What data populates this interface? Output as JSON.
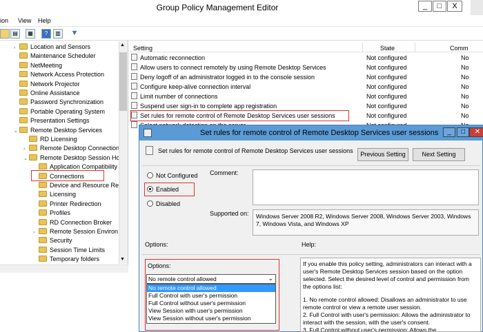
{
  "window": {
    "title": "Group Policy Management Editor",
    "min": "_",
    "max": "□",
    "close": "X"
  },
  "menu": [
    "ion",
    "View",
    "Help"
  ],
  "tree": [
    {
      "label": "Location and Sensors",
      "level": 1,
      "exp": "›"
    },
    {
      "label": "Maintenance Scheduler",
      "level": 1,
      "exp": ""
    },
    {
      "label": "NetMeeting",
      "level": 1,
      "exp": ""
    },
    {
      "label": "Network Access Protection",
      "level": 1,
      "exp": ""
    },
    {
      "label": "Network Projector",
      "level": 1,
      "exp": ""
    },
    {
      "label": "Online Assistance",
      "level": 1,
      "exp": ""
    },
    {
      "label": "Password Synchronization",
      "level": 1,
      "exp": ""
    },
    {
      "label": "Portable Operating System",
      "level": 1,
      "exp": ""
    },
    {
      "label": "Presentation Settings",
      "level": 1,
      "exp": ""
    },
    {
      "label": "Remote Desktop Services",
      "level": 1,
      "exp": "⌄"
    },
    {
      "label": "RD Licensing",
      "level": 2,
      "exp": ""
    },
    {
      "label": "Remote Desktop Connection",
      "level": 2,
      "exp": "›"
    },
    {
      "label": "Remote Desktop Session Hos",
      "level": 2,
      "exp": "⌄"
    },
    {
      "label": "Application Compatibility",
      "level": 3,
      "exp": ""
    },
    {
      "label": "Connections",
      "level": 3,
      "exp": ""
    },
    {
      "label": "Device and Resource Red",
      "level": 3,
      "exp": ""
    },
    {
      "label": "Licensing",
      "level": 3,
      "exp": ""
    },
    {
      "label": "Printer Redirection",
      "level": 3,
      "exp": ""
    },
    {
      "label": "Profiles",
      "level": 3,
      "exp": ""
    },
    {
      "label": "RD Connection Broker",
      "level": 3,
      "exp": ""
    },
    {
      "label": "Remote Session Environ",
      "level": 3,
      "exp": "›"
    },
    {
      "label": "Security",
      "level": 3,
      "exp": ""
    },
    {
      "label": "Session Time Limits",
      "level": 3,
      "exp": ""
    },
    {
      "label": "Temporary folders",
      "level": 3,
      "exp": ""
    }
  ],
  "list": {
    "headers": {
      "setting": "Setting",
      "state": "State",
      "comment": "Comm"
    },
    "rows": [
      {
        "setting": "Automatic reconnection",
        "state": "Not configured",
        "comment": "No"
      },
      {
        "setting": "Allow users to connect remotely by using Remote Desktop Services",
        "state": "Not configured",
        "comment": "No"
      },
      {
        "setting": "Deny logoff of an administrator logged in to the console session",
        "state": "Not configured",
        "comment": "No"
      },
      {
        "setting": "Configure keep-alive connection interval",
        "state": "Not configured",
        "comment": "No"
      },
      {
        "setting": "Limit number of connections",
        "state": "Not configured",
        "comment": "No"
      },
      {
        "setting": "Suspend user sign-in to complete app registration",
        "state": "Not configured",
        "comment": "No"
      },
      {
        "setting": "Set rules for remote control of Remote Desktop Services user sessions",
        "state": "Not configured",
        "comment": "No"
      },
      {
        "setting": "Select network detection on the server",
        "state": "Not configured",
        "comment": "No"
      }
    ]
  },
  "dialog": {
    "title": "Set rules for remote control of Remote Desktop Services user sessions",
    "heading": "Set rules for remote control of Remote Desktop Services user sessions",
    "prev_button": "Previous Setting",
    "next_button": "Next Setting",
    "radios": {
      "not_configured": "Not Configured",
      "enabled": "Enabled",
      "disabled": "Disabled"
    },
    "comment_label": "Comment:",
    "supported_label": "Supported on:",
    "supported_text": "Windows Server 2008 R2, Windows Server 2008, Windows Server 2003, Windows 7, Windows Vista, and Windows XP",
    "options_header": "Options:",
    "help_header": "Help:",
    "options_label": "Options:",
    "selected_option": "No remote control allowed",
    "dropdown_options": [
      "No remote control allowed",
      "Full Control with user's permission",
      "Full Control without user's permission",
      "View Session with user's permission",
      "View Session without user's permission"
    ],
    "help_text": "If you enable this policy setting, administrators can interact with a user's Remote Desktop Services session based on the option selected. Select the desired level of control and permission from the options list:",
    "help_item1": "1. No remote control allowed: Disallows an administrator to use remote control or view a remote user session.",
    "help_item2": "2. Full Control with user's permission: Allows the administrator to interact with the session, with the user's consent.",
    "help_item3": "3. Full Control without user's permission: Allows the"
  },
  "colors": {
    "accent": "#5a9bd5",
    "highlight": "#e03030",
    "selection": "#3399ff"
  }
}
